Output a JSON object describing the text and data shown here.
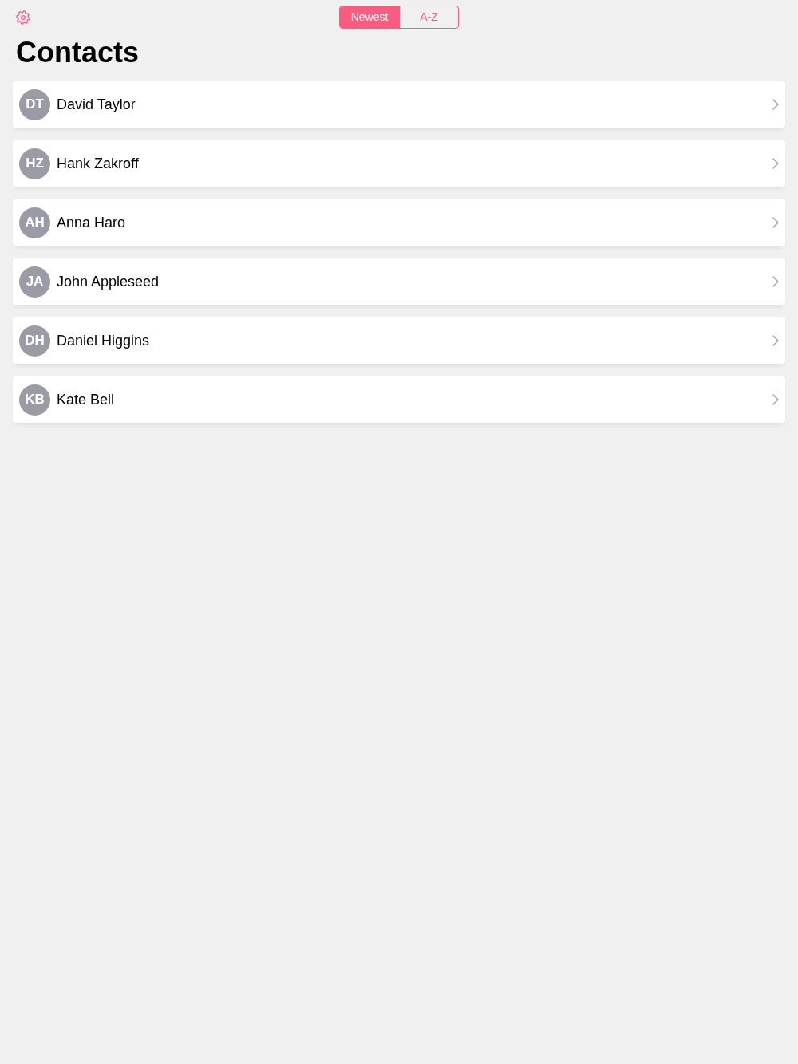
{
  "sort_control": {
    "options": [
      {
        "label": "Newest",
        "selected": true
      },
      {
        "label": "A-Z",
        "selected": false
      }
    ]
  },
  "title": "Contacts",
  "contacts": [
    {
      "initials": "DT",
      "name": "David Taylor"
    },
    {
      "initials": "HZ",
      "name": "Hank Zakroff"
    },
    {
      "initials": "AH",
      "name": "Anna Haro"
    },
    {
      "initials": "JA",
      "name": "John Appleseed"
    },
    {
      "initials": "DH",
      "name": "Daniel Higgins"
    },
    {
      "initials": "KB",
      "name": "Kate Bell"
    }
  ]
}
